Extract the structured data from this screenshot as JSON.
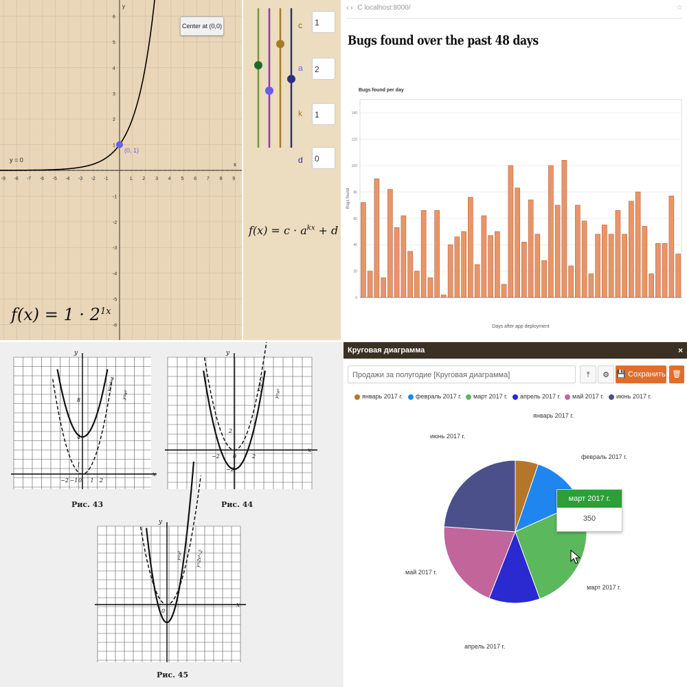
{
  "graph_panel": {
    "center_button": "Center at (0,0)",
    "asymptote_label": "y = 0",
    "point_label": "(0, 1)",
    "axis_x": "x",
    "axis_y": "y",
    "formula": "f(x) = 1 · 2",
    "formula_exp": "1x",
    "x_ticks": [
      "-9",
      "-8",
      "-7",
      "-6",
      "-5",
      "-4",
      "-3",
      "-2",
      "-1",
      "1",
      "2",
      "3",
      "4",
      "5",
      "6",
      "7",
      "8",
      "9"
    ],
    "y_ticks": [
      "6",
      "5",
      "4",
      "3",
      "2",
      "1",
      "-1",
      "-2",
      "-3",
      "-4",
      "-5",
      "-6"
    ],
    "colors": {
      "background": "#e9d6b8",
      "curve": "#000000",
      "point": "#6b5cf0"
    }
  },
  "slider_panel": {
    "params": [
      {
        "name": "c",
        "value": "1",
        "color": "#8a6a10"
      },
      {
        "name": "a",
        "value": "2",
        "color": "#6b5cf0"
      },
      {
        "name": "k",
        "value": "1",
        "color": "#a07820"
      },
      {
        "name": "d",
        "value": "0",
        "color": "#2a2a8a"
      }
    ],
    "formula": "f(x) = c · a",
    "formula_exp": "kx",
    "formula_tail": " + d",
    "slider_colors": [
      "#6f9e2f",
      "#8b3fa3",
      "#a57c20",
      "#2c2f7a"
    ]
  },
  "bug_panel": {
    "address": "C  localhost:8000/",
    "title": "Bugs found over the past 48 days",
    "chart_data": {
      "type": "bar",
      "title": "Bugs found per day",
      "xlabel": "Days after app deployment",
      "ylabel": "Bugs found",
      "ylim": [
        0,
        150
      ],
      "y_ticks": [
        "0",
        "20",
        "40",
        "60",
        "80",
        "100",
        "120",
        "140"
      ],
      "values": [
        72,
        20,
        90,
        15,
        82,
        53,
        62,
        35,
        20,
        66,
        15,
        66,
        2,
        40,
        46,
        50,
        76,
        25,
        62,
        47,
        50,
        10,
        100,
        83,
        42,
        74,
        48,
        28,
        100,
        70,
        104,
        24,
        70,
        58,
        18,
        48,
        55,
        48,
        66,
        48,
        73,
        80,
        54,
        18,
        41,
        41,
        77,
        33
      ],
      "color": "#e8956a"
    }
  },
  "parabola_panel": {
    "fig43": {
      "caption": "Рис. 43",
      "labels": [
        "y",
        "x",
        "8",
        "4",
        "1",
        "−2",
        "−1",
        "0",
        "1",
        "2"
      ],
      "curve_labels": [
        "y=x²+4",
        "y=x²"
      ]
    },
    "fig44": {
      "caption": "Рис. 44",
      "labels": [
        "y",
        "x",
        "2",
        "−2",
        "0",
        "2",
        "−2"
      ],
      "curve_labels": [
        "y=x²−2",
        "y=x²"
      ]
    },
    "fig45": {
      "caption": "Рис. 45",
      "labels": [
        "y",
        "x",
        "0"
      ],
      "curve_labels": [
        "y=x²",
        "y=2x²−2"
      ]
    }
  },
  "pie_panel": {
    "header": "Круговая диаграмма",
    "input_value": "Продажи за полугодие [Круговая диаграмма]",
    "upload_icon": "upload-icon",
    "settings_icon": "gear-icon",
    "save_label": "Сохранить",
    "delete_icon": "trash-icon",
    "close_icon": "close-icon",
    "tooltip": {
      "title": "март 2017 г.",
      "value": "350"
    },
    "chart_data": {
      "type": "pie",
      "labels": [
        "январь 2017 г.",
        "февраль 2017 г.",
        "март 2017 г.",
        "апрель 2017 г.",
        "май 2017 г.",
        "июнь 2017 г."
      ],
      "values": [
        70,
        175,
        350,
        155,
        270,
        320
      ],
      "colors": [
        "#b5762a",
        "#1f86f0",
        "#5cb85c",
        "#2a2ad0",
        "#c1659a",
        "#4b4f8a"
      ],
      "legend_position": "top"
    }
  }
}
